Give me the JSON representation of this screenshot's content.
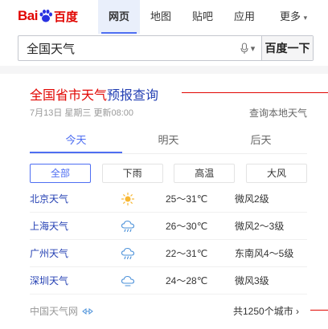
{
  "logo": {
    "part1": "Bai",
    "part2": "百度"
  },
  "nav": [
    {
      "label": "网页",
      "active": true
    },
    {
      "label": "地图",
      "active": false
    },
    {
      "label": "贴吧",
      "active": false
    },
    {
      "label": "应用",
      "active": false
    }
  ],
  "nav_more": "更多",
  "search": {
    "value": "全国天气",
    "button": "百度一下"
  },
  "card": {
    "title_a": "全国省市天气",
    "title_b": "预报查询",
    "meta": "7月13日 星期三 更新08:00",
    "local_link": "查询本地天气"
  },
  "tabs": [
    {
      "label": "今天",
      "active": true
    },
    {
      "label": "明天",
      "active": false
    },
    {
      "label": "后天",
      "active": false
    }
  ],
  "filters": [
    {
      "label": "全部",
      "active": true
    },
    {
      "label": "下雨",
      "active": false
    },
    {
      "label": "高温",
      "active": false
    },
    {
      "label": "大风",
      "active": false
    }
  ],
  "weather": [
    {
      "city": "北京天气",
      "icon": "sun-icon",
      "temp": "25～31℃",
      "wind": "微风2级"
    },
    {
      "city": "上海天气",
      "icon": "cloud-rain-icon",
      "temp": "26～30℃",
      "wind": "微风2～3级"
    },
    {
      "city": "广州天气",
      "icon": "cloud-rain-icon",
      "temp": "22～31℃",
      "wind": "东南风4～5级"
    },
    {
      "city": "深圳天气",
      "icon": "cloud-icon",
      "temp": "24～28℃",
      "wind": "微风3级"
    }
  ],
  "footer": {
    "source": "中国天气网",
    "count": "共1250个城市 ›"
  },
  "colors": {
    "accent": "#4e6ef2",
    "brand_red": "#e10602",
    "link_blue": "#2440b3"
  }
}
